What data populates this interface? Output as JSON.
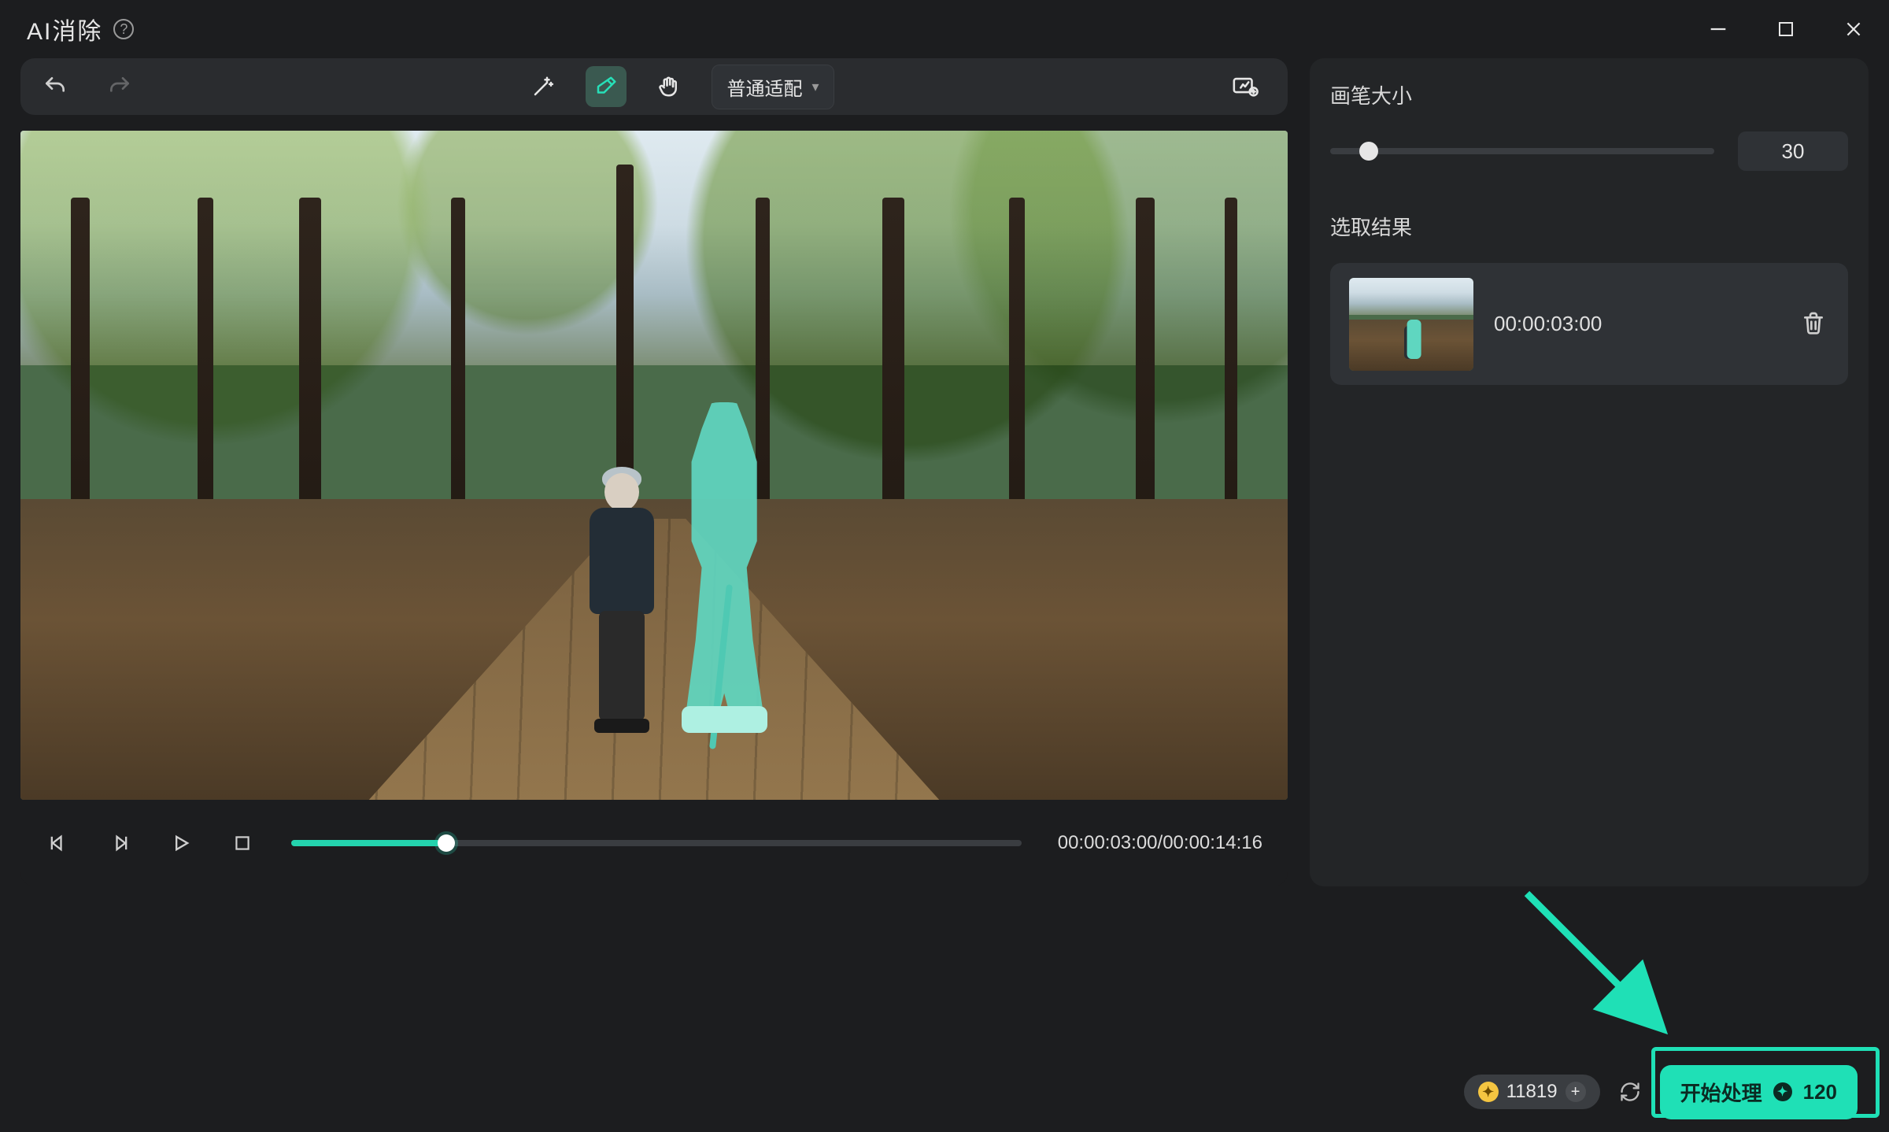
{
  "window": {
    "title": "AI消除"
  },
  "toolbar": {
    "fit_mode": "普通适配"
  },
  "playback": {
    "current": "00:00:03:00",
    "total": "00:00:14:16"
  },
  "sidebar": {
    "brush_label": "画笔大小",
    "brush_value": "30",
    "results_label": "选取结果",
    "results": [
      {
        "time": "00:00:03:00"
      }
    ]
  },
  "footer": {
    "credits": "11819",
    "start_label": "开始处理",
    "start_cost": "120"
  },
  "colors": {
    "accent": "#1fe0b6",
    "mask": "#5fd6c0"
  }
}
